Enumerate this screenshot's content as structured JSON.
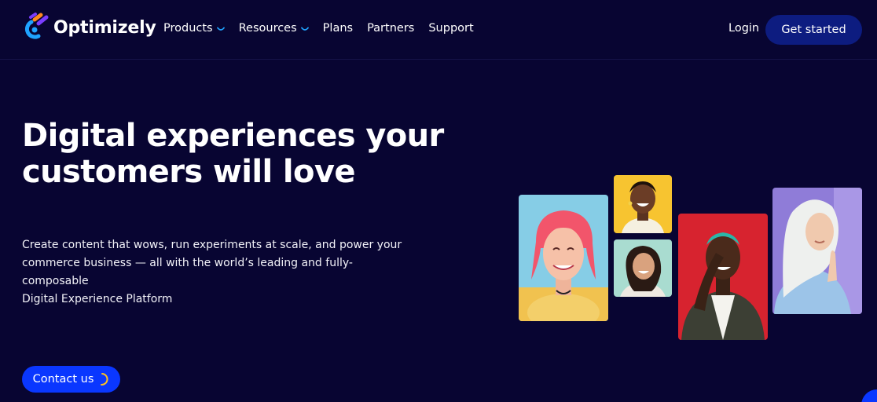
{
  "header": {
    "brand": "Optimizely",
    "nav": [
      {
        "label": "Products",
        "has_dropdown": true
      },
      {
        "label": "Resources",
        "has_dropdown": true
      },
      {
        "label": "Plans",
        "has_dropdown": false
      },
      {
        "label": "Partners",
        "has_dropdown": false
      },
      {
        "label": "Support",
        "has_dropdown": false
      }
    ],
    "login_label": "Login",
    "cta_label": "Get started"
  },
  "hero": {
    "title_line1": "Digital experiences your",
    "title_line2": "customers will love",
    "body_line1": "Create content that wows, run experiments at scale, and power your",
    "body_line2": "commerce business — all with the world’s leading and fully-composable",
    "body_line3": "Digital Experience Platform",
    "contact_label": "Contact us"
  },
  "icons": {
    "logo": "optimizely-logo-icon",
    "dropdown": "chevron-down-icon",
    "loading": "loading-spinner-icon"
  },
  "colors": {
    "background": "#080532",
    "cta_dark": "#0d1c80",
    "primary_blue": "#0a37ff",
    "accent_cyan": "#1fa3ff"
  }
}
